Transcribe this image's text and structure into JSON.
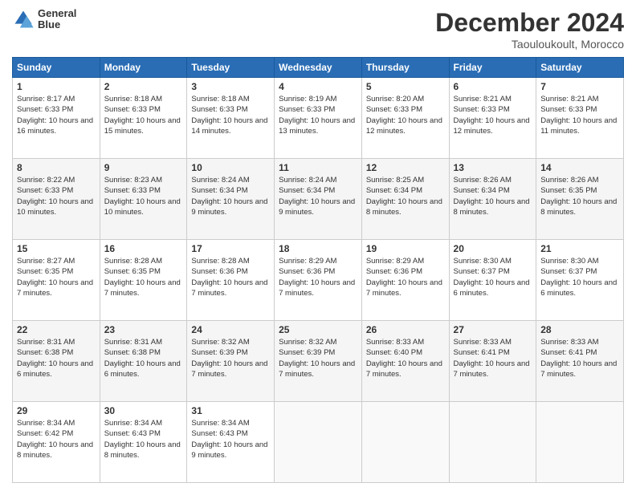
{
  "header": {
    "logo_line1": "General",
    "logo_line2": "Blue",
    "month": "December 2024",
    "location": "Taouloukoult, Morocco"
  },
  "days_of_week": [
    "Sunday",
    "Monday",
    "Tuesday",
    "Wednesday",
    "Thursday",
    "Friday",
    "Saturday"
  ],
  "weeks": [
    [
      {
        "day": 1,
        "sunrise": "8:17 AM",
        "sunset": "6:33 PM",
        "daylight": "10 hours and 16 minutes."
      },
      {
        "day": 2,
        "sunrise": "8:18 AM",
        "sunset": "6:33 PM",
        "daylight": "10 hours and 15 minutes."
      },
      {
        "day": 3,
        "sunrise": "8:18 AM",
        "sunset": "6:33 PM",
        "daylight": "10 hours and 14 minutes."
      },
      {
        "day": 4,
        "sunrise": "8:19 AM",
        "sunset": "6:33 PM",
        "daylight": "10 hours and 13 minutes."
      },
      {
        "day": 5,
        "sunrise": "8:20 AM",
        "sunset": "6:33 PM",
        "daylight": "10 hours and 12 minutes."
      },
      {
        "day": 6,
        "sunrise": "8:21 AM",
        "sunset": "6:33 PM",
        "daylight": "10 hours and 12 minutes."
      },
      {
        "day": 7,
        "sunrise": "8:21 AM",
        "sunset": "6:33 PM",
        "daylight": "10 hours and 11 minutes."
      }
    ],
    [
      {
        "day": 8,
        "sunrise": "8:22 AM",
        "sunset": "6:33 PM",
        "daylight": "10 hours and 10 minutes."
      },
      {
        "day": 9,
        "sunrise": "8:23 AM",
        "sunset": "6:33 PM",
        "daylight": "10 hours and 10 minutes."
      },
      {
        "day": 10,
        "sunrise": "8:24 AM",
        "sunset": "6:34 PM",
        "daylight": "10 hours and 9 minutes."
      },
      {
        "day": 11,
        "sunrise": "8:24 AM",
        "sunset": "6:34 PM",
        "daylight": "10 hours and 9 minutes."
      },
      {
        "day": 12,
        "sunrise": "8:25 AM",
        "sunset": "6:34 PM",
        "daylight": "10 hours and 8 minutes."
      },
      {
        "day": 13,
        "sunrise": "8:26 AM",
        "sunset": "6:34 PM",
        "daylight": "10 hours and 8 minutes."
      },
      {
        "day": 14,
        "sunrise": "8:26 AM",
        "sunset": "6:35 PM",
        "daylight": "10 hours and 8 minutes."
      }
    ],
    [
      {
        "day": 15,
        "sunrise": "8:27 AM",
        "sunset": "6:35 PM",
        "daylight": "10 hours and 7 minutes."
      },
      {
        "day": 16,
        "sunrise": "8:28 AM",
        "sunset": "6:35 PM",
        "daylight": "10 hours and 7 minutes."
      },
      {
        "day": 17,
        "sunrise": "8:28 AM",
        "sunset": "6:36 PM",
        "daylight": "10 hours and 7 minutes."
      },
      {
        "day": 18,
        "sunrise": "8:29 AM",
        "sunset": "6:36 PM",
        "daylight": "10 hours and 7 minutes."
      },
      {
        "day": 19,
        "sunrise": "8:29 AM",
        "sunset": "6:36 PM",
        "daylight": "10 hours and 7 minutes."
      },
      {
        "day": 20,
        "sunrise": "8:30 AM",
        "sunset": "6:37 PM",
        "daylight": "10 hours and 6 minutes."
      },
      {
        "day": 21,
        "sunrise": "8:30 AM",
        "sunset": "6:37 PM",
        "daylight": "10 hours and 6 minutes."
      }
    ],
    [
      {
        "day": 22,
        "sunrise": "8:31 AM",
        "sunset": "6:38 PM",
        "daylight": "10 hours and 6 minutes."
      },
      {
        "day": 23,
        "sunrise": "8:31 AM",
        "sunset": "6:38 PM",
        "daylight": "10 hours and 6 minutes."
      },
      {
        "day": 24,
        "sunrise": "8:32 AM",
        "sunset": "6:39 PM",
        "daylight": "10 hours and 7 minutes."
      },
      {
        "day": 25,
        "sunrise": "8:32 AM",
        "sunset": "6:39 PM",
        "daylight": "10 hours and 7 minutes."
      },
      {
        "day": 26,
        "sunrise": "8:33 AM",
        "sunset": "6:40 PM",
        "daylight": "10 hours and 7 minutes."
      },
      {
        "day": 27,
        "sunrise": "8:33 AM",
        "sunset": "6:41 PM",
        "daylight": "10 hours and 7 minutes."
      },
      {
        "day": 28,
        "sunrise": "8:33 AM",
        "sunset": "6:41 PM",
        "daylight": "10 hours and 7 minutes."
      }
    ],
    [
      {
        "day": 29,
        "sunrise": "8:34 AM",
        "sunset": "6:42 PM",
        "daylight": "10 hours and 8 minutes."
      },
      {
        "day": 30,
        "sunrise": "8:34 AM",
        "sunset": "6:43 PM",
        "daylight": "10 hours and 8 minutes."
      },
      {
        "day": 31,
        "sunrise": "8:34 AM",
        "sunset": "6:43 PM",
        "daylight": "10 hours and 9 minutes."
      },
      null,
      null,
      null,
      null
    ]
  ],
  "labels": {
    "sunrise": "Sunrise:",
    "sunset": "Sunset:",
    "daylight": "Daylight:"
  }
}
